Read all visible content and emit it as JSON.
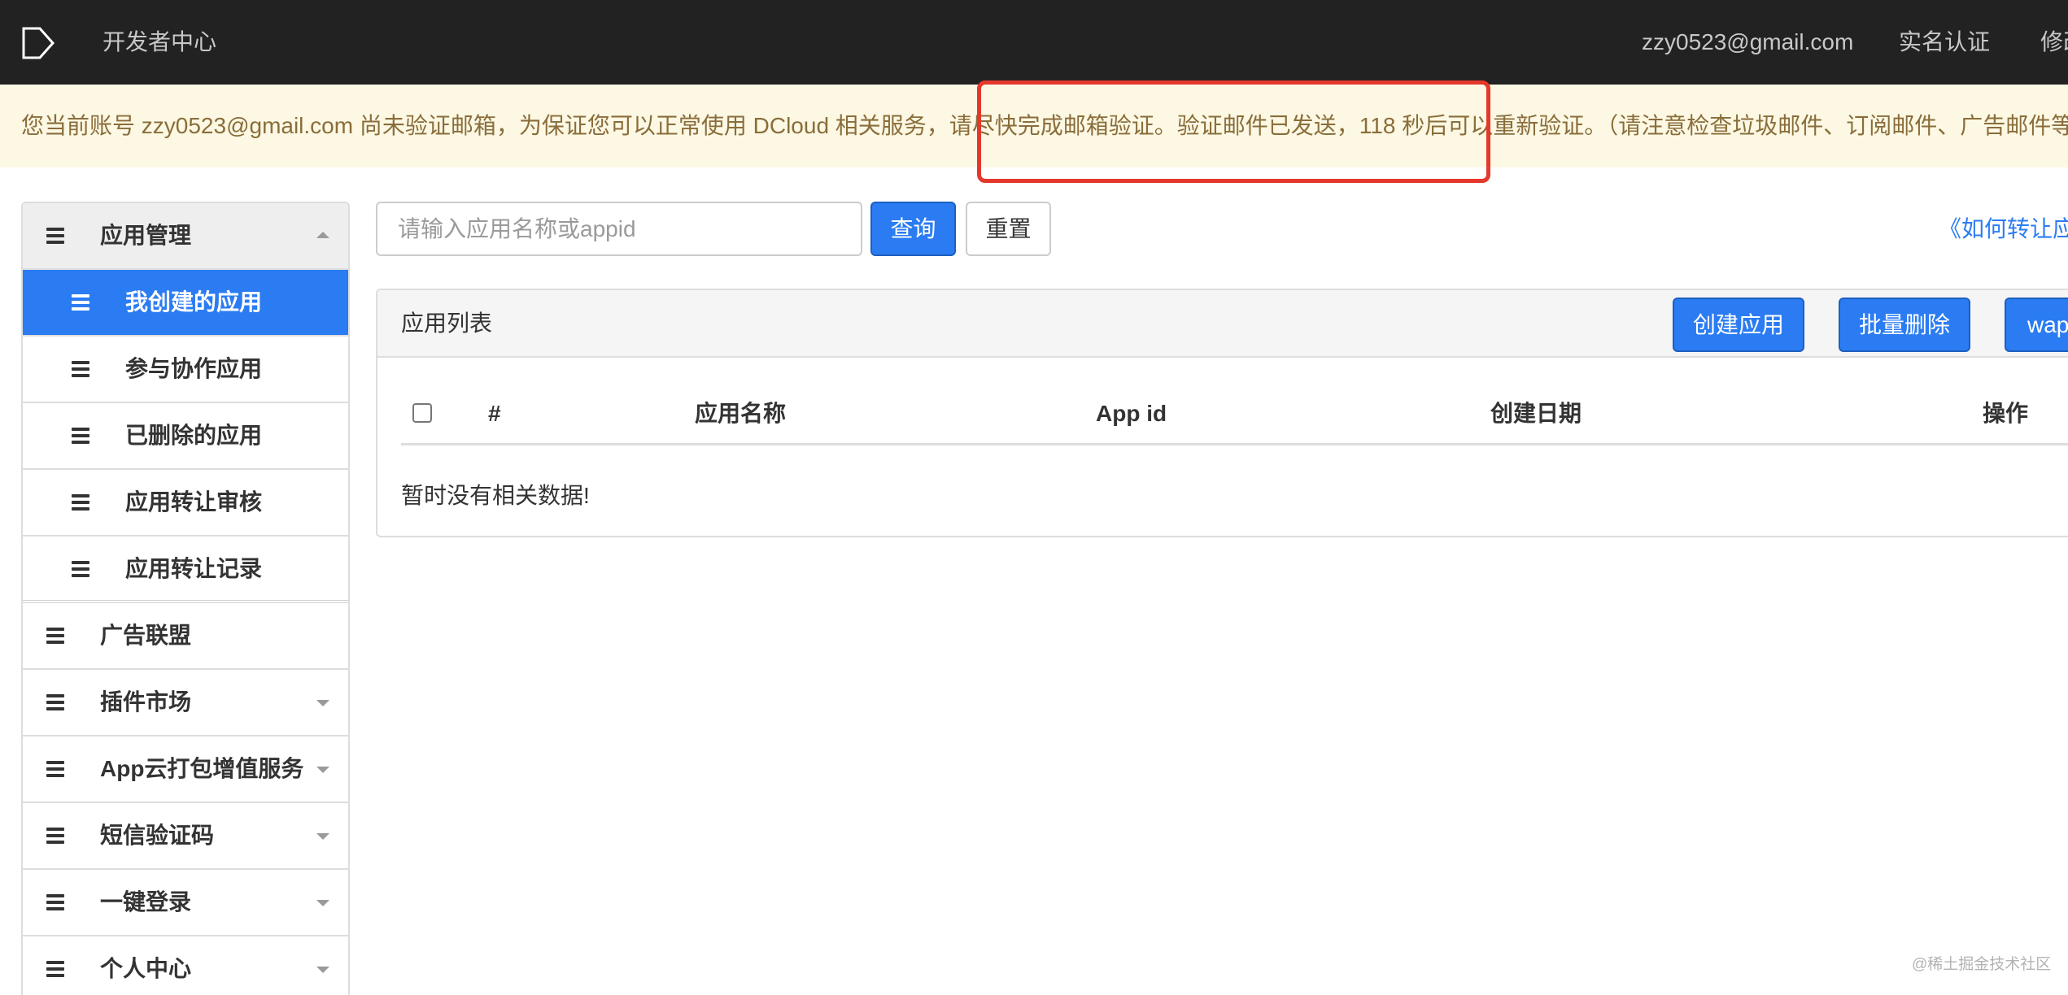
{
  "header": {
    "logo_icon": "dcloud-logo-icon",
    "title": "开发者中心",
    "email": "zzy0523@gmail.com",
    "verify_link": "实名认证",
    "truncated_link": "修改"
  },
  "notice": {
    "text": "您当前账号 zzy0523@gmail.com 尚未验证邮箱，为保证您可以正常使用 DCloud 相关服务，请尽快完成邮箱验证。验证邮件已发送，118 秒后可以重新验证。（请注意检查垃圾邮件、订阅邮件、广告邮件等",
    "annotation_color": "#e5382d"
  },
  "sidebar": {
    "items": [
      {
        "label": "应用管理",
        "icon": "menu-icon",
        "caret_icon": "caret-up-icon"
      },
      {
        "label": "我创建的应用",
        "icon": "menu-icon",
        "active": true
      },
      {
        "label": "参与协作应用",
        "icon": "menu-icon"
      },
      {
        "label": "已删除的应用",
        "icon": "menu-icon"
      },
      {
        "label": "应用转让审核",
        "icon": "menu-icon"
      },
      {
        "label": "应用转让记录",
        "icon": "menu-icon"
      },
      {
        "label": "广告联盟",
        "icon": "menu-icon"
      },
      {
        "label": "插件市场",
        "icon": "menu-icon",
        "caret_icon": "caret-down-icon"
      },
      {
        "label": "App云打包增值服务",
        "icon": "menu-icon",
        "caret_icon": "caret-down-icon"
      },
      {
        "label": "短信验证码",
        "icon": "menu-icon",
        "caret_icon": "caret-down-icon"
      },
      {
        "label": "一键登录",
        "icon": "menu-icon",
        "caret_icon": "caret-down-icon"
      },
      {
        "label": "个人中心",
        "icon": "menu-icon",
        "caret_icon": "caret-down-icon"
      }
    ]
  },
  "search": {
    "placeholder": "请输入应用名称或appid",
    "value": "",
    "submit_label": "查询",
    "reset_label": "重置",
    "help_link": "《如何转让应"
  },
  "app_list": {
    "title": "应用列表",
    "actions": [
      "创建应用",
      "批量删除",
      "wap"
    ],
    "columns": [
      "#",
      "应用名称",
      "App id",
      "创建日期",
      "操作"
    ],
    "rows": [],
    "empty_text": "暂时没有相关数据!"
  },
  "watermark": "@稀土掘金技术社区",
  "colors": {
    "accent": "#2b7cf2",
    "header_bg": "#222222",
    "notice_bg": "#fcf8e3",
    "notice_text": "#8a6d3b"
  }
}
